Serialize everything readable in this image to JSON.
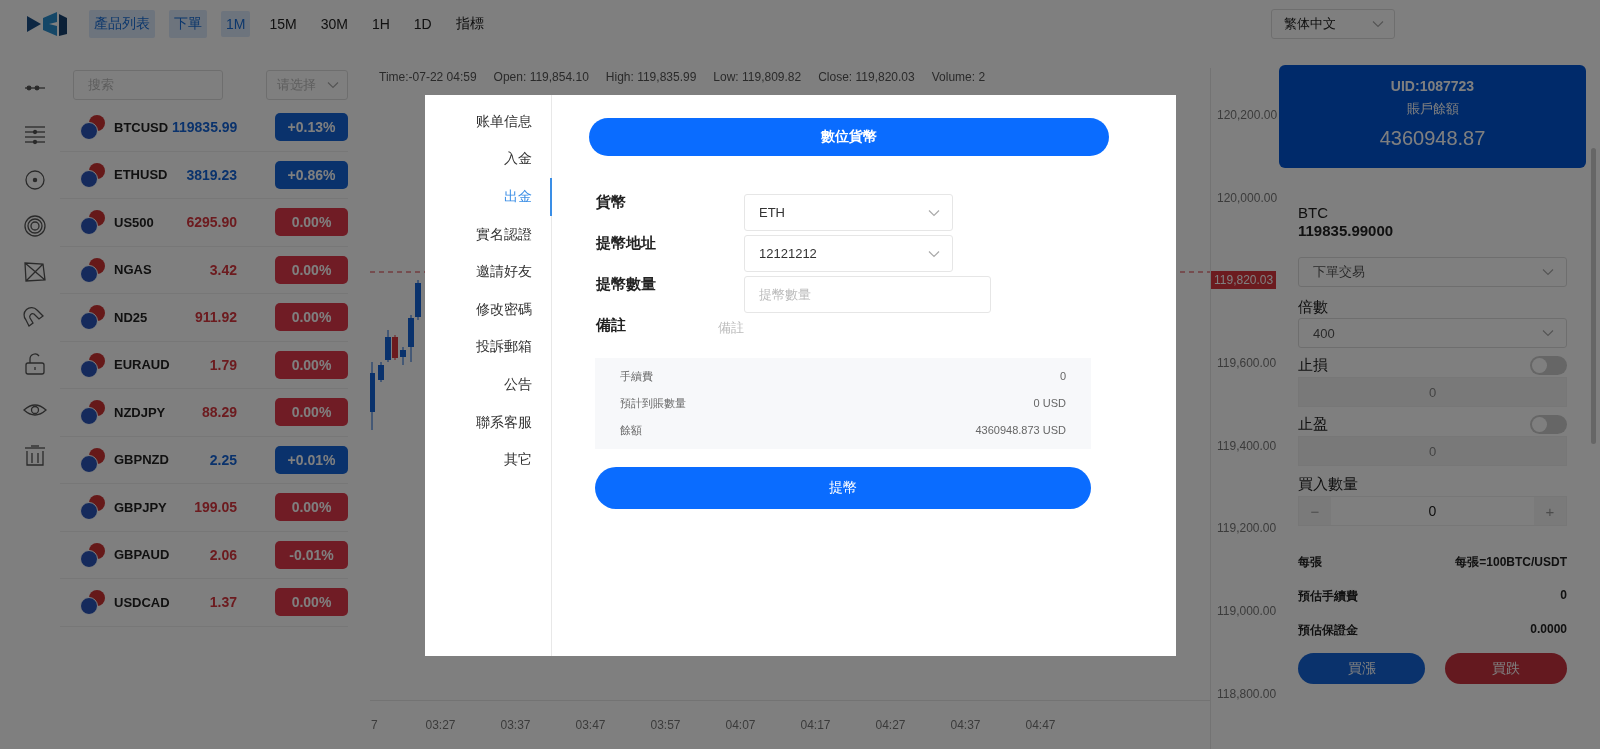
{
  "top_nav": {
    "items": [
      {
        "label": "產品列表",
        "selected": true
      },
      {
        "label": "下單",
        "selected": true
      },
      {
        "label": "1M",
        "selected": true
      },
      {
        "label": "15M",
        "selected": false
      },
      {
        "label": "30M",
        "selected": false
      },
      {
        "label": "1H",
        "selected": false
      },
      {
        "label": "1D",
        "selected": false
      },
      {
        "label": "指標",
        "selected": false
      }
    ],
    "language": "繁体中文"
  },
  "product_list": {
    "search_placeholder": "搜索",
    "filter_placeholder": "请选择",
    "rows": [
      {
        "symbol": "BTCUSD",
        "price": "119835.99",
        "change": "+0.13%",
        "rising": true
      },
      {
        "symbol": "ETHUSD",
        "price": "3819.23",
        "change": "+0.86%",
        "rising": true
      },
      {
        "symbol": "US500",
        "price": "6295.90",
        "change": "0.00%",
        "rising": false
      },
      {
        "symbol": "NGAS",
        "price": "3.42",
        "change": "0.00%",
        "rising": false
      },
      {
        "symbol": "ND25",
        "price": "911.92",
        "change": "0.00%",
        "rising": false
      },
      {
        "symbol": "EURAUD",
        "price": "1.79",
        "change": "0.00%",
        "rising": false
      },
      {
        "symbol": "NZDJPY",
        "price": "88.29",
        "change": "0.00%",
        "rising": false
      },
      {
        "symbol": "GBPNZD",
        "price": "2.25",
        "change": "+0.01%",
        "rising": true
      },
      {
        "symbol": "GBPJPY",
        "price": "199.05",
        "change": "0.00%",
        "rising": false
      },
      {
        "symbol": "GBPAUD",
        "price": "2.06",
        "change": "-0.01%",
        "rising": false
      },
      {
        "symbol": "USDCAD",
        "price": "1.37",
        "change": "0.00%",
        "rising": false
      }
    ]
  },
  "chart": {
    "info": [
      "Time:-07-22 04:59",
      "Open: 119,854.10",
      "High: 119,835.99",
      "Low: 119,809.82",
      "Close: 119,820.03",
      "Volume: 2"
    ],
    "y_labels": [
      {
        "text": "120,200.00",
        "kind": "tick"
      },
      {
        "text": "120,000.00",
        "kind": "tick"
      },
      {
        "text": "119,820.03",
        "kind": "current"
      },
      {
        "text": "119,600.00",
        "kind": "tick"
      },
      {
        "text": "119,400.00",
        "kind": "tick"
      },
      {
        "text": "119,200.00",
        "kind": "tick"
      },
      {
        "text": "119,000.00",
        "kind": "tick"
      },
      {
        "text": "118,800.00",
        "kind": "tick"
      }
    ],
    "x_labels": [
      "7",
      "03:27",
      "03:37",
      "03:47",
      "03:57",
      "04:07",
      "04:17",
      "04:27",
      "04:37",
      "04:47"
    ]
  },
  "account": {
    "uid": "UID:1087723",
    "balance_label": "賬戶餘額",
    "balance": "4360948.87"
  },
  "order": {
    "symbol": "BTC",
    "price": "119835.99000",
    "order_type": "下單交易",
    "leverage_label": "倍數",
    "leverage": "400",
    "stop_loss": {
      "label": "止損",
      "on": false,
      "placeholder": "0"
    },
    "take_profit": {
      "label": "止盈",
      "on": false,
      "placeholder": "0"
    },
    "quantity_label": "買入數量",
    "quantity": "0",
    "decrement": "−",
    "increment": "+",
    "summary": [
      {
        "label": "每張",
        "value": "每張=100BTC/USDT"
      },
      {
        "label": "預估手續費",
        "value": "0"
      },
      {
        "label": "預估保證金",
        "value": "0.0000"
      }
    ],
    "buy_label": "買漲",
    "sell_label": "買跌"
  },
  "modal": {
    "menu": [
      {
        "label": "账单信息",
        "selected": false
      },
      {
        "label": "入金",
        "selected": false
      },
      {
        "label": "出金",
        "selected": true
      },
      {
        "label": "實名認證",
        "selected": false
      },
      {
        "label": "邀請好友",
        "selected": false
      },
      {
        "label": "修改密碼",
        "selected": false
      },
      {
        "label": "投訴郵箱",
        "selected": false
      },
      {
        "label": "公告",
        "selected": false
      },
      {
        "label": "聯系客服",
        "selected": false
      },
      {
        "label": "其它",
        "selected": false
      }
    ],
    "tab_button": "數位貨幣",
    "fields": [
      {
        "label": "貨幣",
        "kind": "select",
        "value": "ETH"
      },
      {
        "label": "提幣地址",
        "kind": "select",
        "value": "12121212"
      },
      {
        "label": "提幣數量",
        "kind": "input",
        "placeholder": "提幣數量"
      },
      {
        "label": "備註",
        "kind": "plain",
        "placeholder": "備註"
      }
    ],
    "summary": [
      {
        "label": "手續費",
        "value": "0"
      },
      {
        "label": "預計到賬數量",
        "value": "0 USD"
      },
      {
        "label": "餘額",
        "value": "4360948.873 USD"
      }
    ],
    "submit": "提幣"
  }
}
